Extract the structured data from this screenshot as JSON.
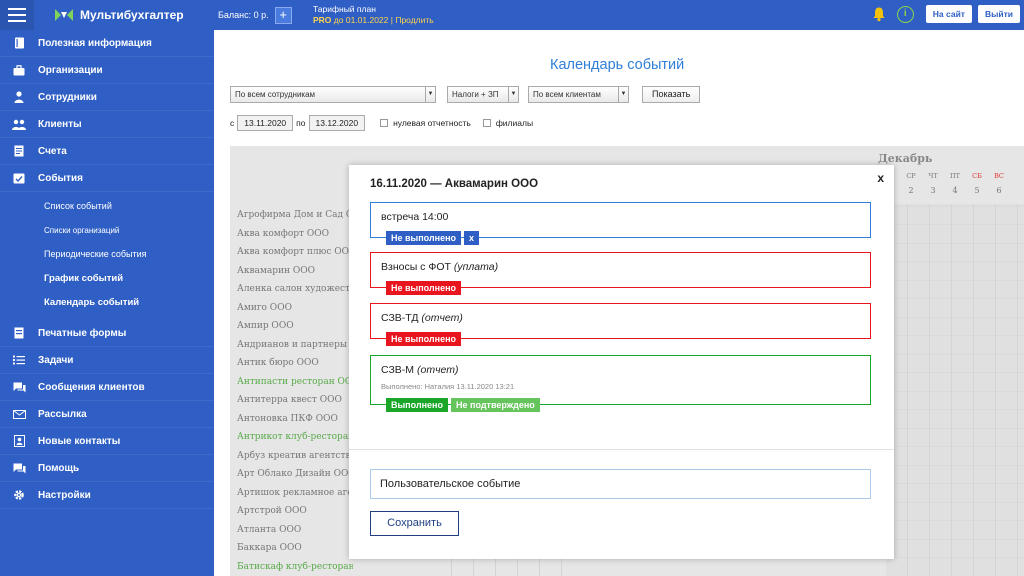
{
  "header": {
    "app_name": "Мультибухгалтер",
    "balance_label": "Баланс: 0 р.",
    "balance_add": "+",
    "tariff_label": "Тарифный план",
    "tariff_pro": "PRO",
    "tariff_date": "до 01.01.2022",
    "tariff_separator": " | ",
    "tariff_extend": "Продлить",
    "to_site_label": "На сайт",
    "logout_label": "Выйти",
    "info_glyph": "i"
  },
  "sidebar": {
    "items": [
      {
        "label": "Полезная информация",
        "icon": "book-icon"
      },
      {
        "label": "Организации",
        "icon": "briefcase-icon"
      },
      {
        "label": "Сотрудники",
        "icon": "user-icon"
      },
      {
        "label": "Клиенты",
        "icon": "users-icon"
      },
      {
        "label": "Счета",
        "icon": "document-icon"
      },
      {
        "label": "События",
        "icon": "calendar-check-icon"
      }
    ],
    "sub_items": [
      {
        "label": "Список событий"
      },
      {
        "label": "Списки организаций"
      },
      {
        "label": "Периодические события"
      },
      {
        "label": "График событий"
      },
      {
        "label": "Календарь событий"
      }
    ],
    "items2": [
      {
        "label": "Печатные формы",
        "icon": "print-forms-icon"
      },
      {
        "label": "Задачи",
        "icon": "tasks-icon"
      },
      {
        "label": "Сообщения клиентов",
        "icon": "messages-icon"
      },
      {
        "label": "Рассылка",
        "icon": "envelope-icon"
      },
      {
        "label": "Новые контакты",
        "icon": "contacts-icon"
      },
      {
        "label": "Помощь",
        "icon": "help-icon"
      },
      {
        "label": "Настройки",
        "icon": "gear-icon"
      }
    ]
  },
  "main": {
    "title": "Календарь событий",
    "filter_employees": "По всем сотрудникам",
    "filter_type": "Налоги + ЗП",
    "filter_clients": "По всем клиентам",
    "show_label": "Показать",
    "from_label": "с",
    "date_from": "13.11.2020",
    "to_label": "по",
    "date_to": "13.12.2020",
    "zero_reports_label": "нулевая отчетность",
    "branches_label": "филиалы"
  },
  "calendar": {
    "month": "Декабрь",
    "weekdays": [
      "СР",
      "ЧТ",
      "ПТ",
      "СБ",
      "ВС"
    ],
    "days": [
      "2",
      "3",
      "4",
      "5",
      "6"
    ],
    "organizations": [
      {
        "name": "Агрофирма Дом и Сад ООО",
        "green": false
      },
      {
        "name": "Аква комфорт ООО",
        "green": false
      },
      {
        "name": "Аква комфорт плюс ООО",
        "green": false
      },
      {
        "name": "Аквамарин ООО",
        "green": false
      },
      {
        "name": "Аленка салон художественный",
        "green": false
      },
      {
        "name": "Амиго ООО",
        "green": false
      },
      {
        "name": "Ампир ООО",
        "green": false
      },
      {
        "name": "Андрианов и партнеры ООО",
        "green": false
      },
      {
        "name": "Антик бюро ООО",
        "green": false
      },
      {
        "name": "Антипасти ресторан ООО",
        "green": true
      },
      {
        "name": "Антитерра квест ООО",
        "green": false
      },
      {
        "name": "Антоновка ПКФ ООО",
        "green": false
      },
      {
        "name": "Антрикот клуб-ресторан ООО",
        "green": true
      },
      {
        "name": "Арбуз креатив агентство ООО",
        "green": false
      },
      {
        "name": "Арт Облако Дизайн ООО",
        "green": false
      },
      {
        "name": "Артишок рекламное агентство",
        "green": false
      },
      {
        "name": "Артстрой ООО",
        "green": false
      },
      {
        "name": "Атланта ООО",
        "green": false
      },
      {
        "name": "Баккара ООО",
        "green": false
      },
      {
        "name": "Батискаф клуб-ресторан ООО",
        "green": true
      }
    ]
  },
  "modal": {
    "title": "16.11.2020 — Аквамарин ООО",
    "close": "x",
    "events": [
      {
        "name": "встреча 14:00",
        "kind": "",
        "sub": "",
        "tags": [
          {
            "text": "Не выполнено",
            "color": "blue"
          },
          {
            "text": "x",
            "color": "x"
          }
        ],
        "border": "#2f7fd8"
      },
      {
        "name": "Взносы с ФОТ",
        "kind": "(уплата)",
        "sub": "",
        "tags": [
          {
            "text": "Не выполнено",
            "color": "red"
          }
        ],
        "border": "#e8141e"
      },
      {
        "name": "СЗВ-ТД",
        "kind": "(отчет)",
        "sub": "",
        "tags": [
          {
            "text": "Не выполнено",
            "color": "red"
          }
        ],
        "border": "#e8141e"
      },
      {
        "name": "СЗВ-М",
        "kind": "(отчет)",
        "sub": "Выполнено: Наталия 13.11.2020 13:21",
        "tags": [
          {
            "text": "Выполнено",
            "color": "green"
          },
          {
            "text": "Не подтверждено",
            "color": "lgreen"
          }
        ],
        "border": "#19a629"
      }
    ],
    "custom_event_placeholder": "Пользовательское событие",
    "save_label": "Сохранить"
  }
}
